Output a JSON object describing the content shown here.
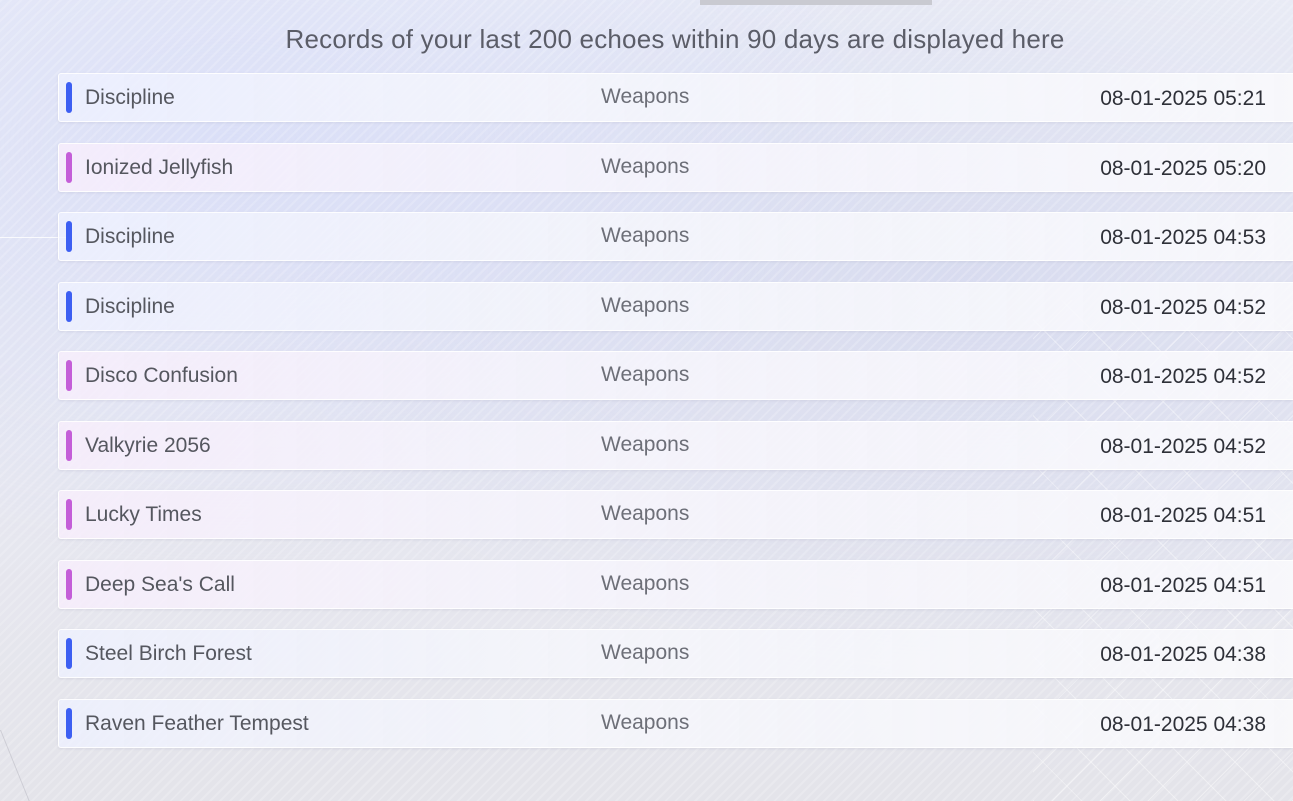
{
  "header": {
    "notice": "Records of your last 200 echoes within 90 days are displayed here"
  },
  "rarity_colors": {
    "blue": "#3d5ff2",
    "purple": "#c45ed8"
  },
  "records": [
    {
      "name": "Discipline",
      "type": "Weapons",
      "time": "08-01-2025 05:21",
      "rarity": "blue"
    },
    {
      "name": "Ionized Jellyfish",
      "type": "Weapons",
      "time": "08-01-2025 05:20",
      "rarity": "purple"
    },
    {
      "name": "Discipline",
      "type": "Weapons",
      "time": "08-01-2025 04:53",
      "rarity": "blue"
    },
    {
      "name": "Discipline",
      "type": "Weapons",
      "time": "08-01-2025 04:52",
      "rarity": "blue"
    },
    {
      "name": "Disco Confusion",
      "type": "Weapons",
      "time": "08-01-2025 04:52",
      "rarity": "purple"
    },
    {
      "name": "Valkyrie 2056",
      "type": "Weapons",
      "time": "08-01-2025 04:52",
      "rarity": "purple"
    },
    {
      "name": "Lucky Times",
      "type": "Weapons",
      "time": "08-01-2025 04:51",
      "rarity": "purple"
    },
    {
      "name": "Deep Sea's Call",
      "type": "Weapons",
      "time": "08-01-2025 04:51",
      "rarity": "purple"
    },
    {
      "name": "Steel Birch Forest",
      "type": "Weapons",
      "time": "08-01-2025 04:38",
      "rarity": "blue"
    },
    {
      "name": "Raven Feather Tempest",
      "type": "Weapons",
      "time": "08-01-2025 04:38",
      "rarity": "blue"
    }
  ]
}
